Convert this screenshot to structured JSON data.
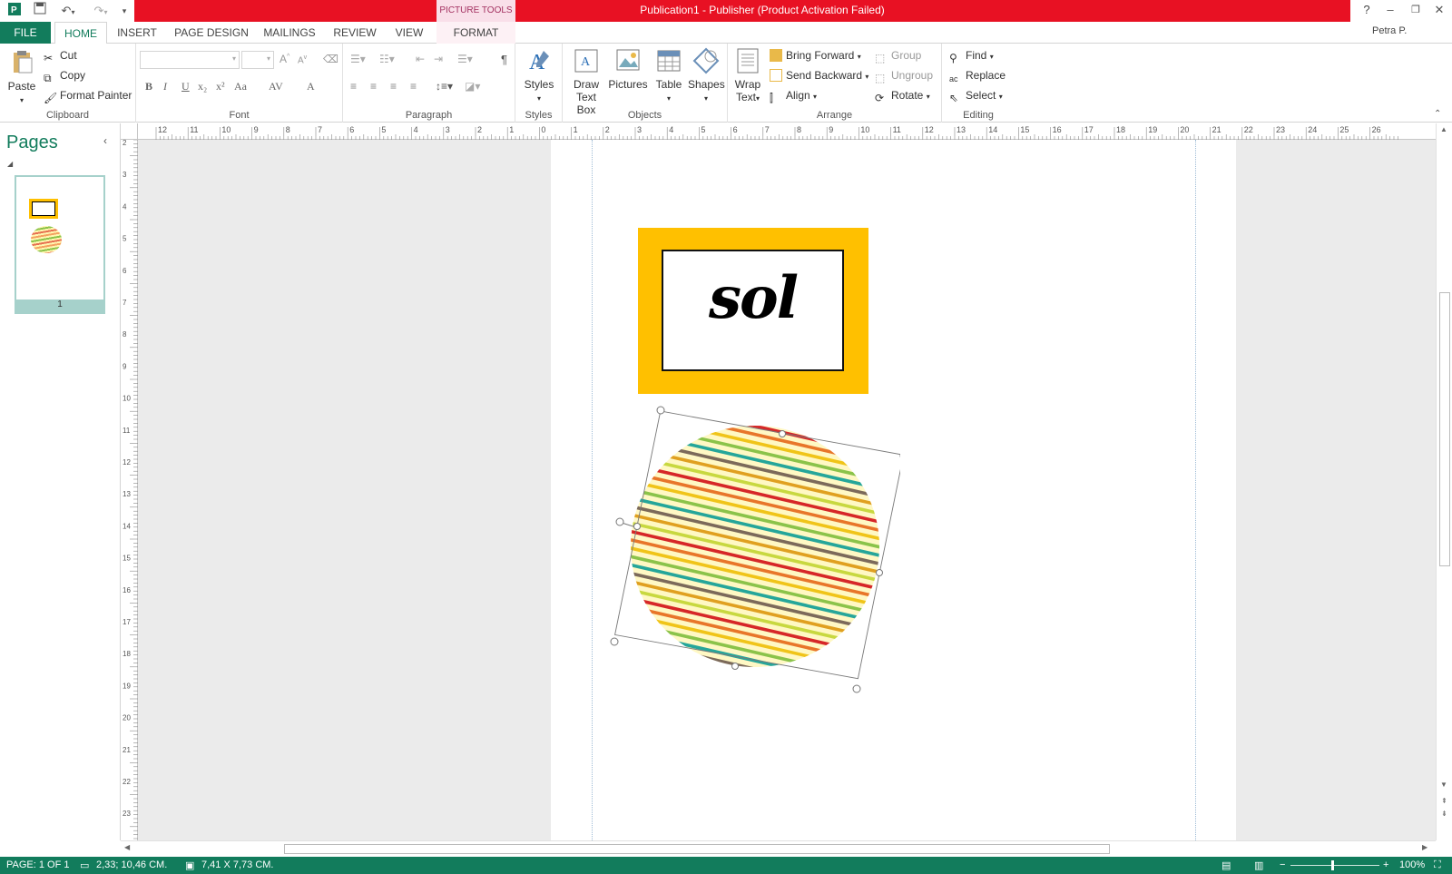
{
  "window": {
    "title": "Publication1 -  Publisher (Product Activation Failed)",
    "context_tab_header": "PICTURE TOOLS",
    "help": "?",
    "user": "Petra P."
  },
  "tabs": [
    "FILE",
    "HOME",
    "INSERT",
    "PAGE DESIGN",
    "MAILINGS",
    "REVIEW",
    "VIEW",
    "FORMAT"
  ],
  "ribbon": {
    "clipboard": {
      "paste": "Paste",
      "cut": "Cut",
      "copy": "Copy",
      "format_painter": "Format Painter",
      "label": "Clipboard"
    },
    "font": {
      "label": "Font",
      "bold": "B",
      "italic": "I",
      "underline": "U",
      "sub": "x₂",
      "sup": "x²",
      "case": "Aa",
      "spacing": "AV",
      "color": "A"
    },
    "paragraph": {
      "label": "Paragraph",
      "pilcrow": "¶"
    },
    "styles": {
      "button": "Styles",
      "label": "Styles"
    },
    "objects": {
      "draw_text_box_1": "Draw",
      "draw_text_box_2": "Text Box",
      "pictures": "Pictures",
      "table": "Table",
      "shapes": "Shapes",
      "label": "Objects"
    },
    "arrange": {
      "wrap_1": "Wrap",
      "wrap_2": "Text",
      "bring_forward": "Bring Forward",
      "send_backward": "Send Backward",
      "align": "Align",
      "group": "Group",
      "ungroup": "Ungroup",
      "rotate": "Rotate",
      "label": "Arrange"
    },
    "editing": {
      "find": "Find",
      "replace": "Replace",
      "select": "Select",
      "label": "Editing"
    }
  },
  "pages_pane": {
    "title": "Pages",
    "page_number": "1"
  },
  "canvas": {
    "text_box_word": "sol"
  },
  "ruler": {
    "h_labels": [
      "12",
      "11",
      "10",
      "9",
      "8",
      "7",
      "6",
      "5",
      "4",
      "3",
      "2",
      "1",
      "0",
      "1",
      "2",
      "3",
      "4",
      "5",
      "6",
      "7",
      "8",
      "9",
      "10",
      "11",
      "12",
      "13",
      "14",
      "15",
      "16",
      "17",
      "18",
      "19",
      "20",
      "21",
      "22",
      "23",
      "24",
      "25",
      "26"
    ],
    "v_labels": [
      "2",
      "3",
      "4",
      "5",
      "6",
      "7",
      "8",
      "9",
      "10",
      "11",
      "12",
      "13",
      "14",
      "15",
      "16",
      "17",
      "18",
      "19",
      "20",
      "21",
      "22",
      "23"
    ]
  },
  "status": {
    "page": "PAGE: 1 OF 1",
    "position": "2,33; 10,46 CM.",
    "size": "7,41 X  7,73 CM.",
    "zoom": "100%"
  },
  "colors": {
    "accent": "#127c5c",
    "title_red": "#e81123",
    "frame_orange": "#ffc000",
    "stripes": [
      "#d62728",
      "#e8762a",
      "#f0c419",
      "#8bc34a",
      "#26a69a",
      "#7c6a5a",
      "#e0a020",
      "#c8d840"
    ]
  }
}
